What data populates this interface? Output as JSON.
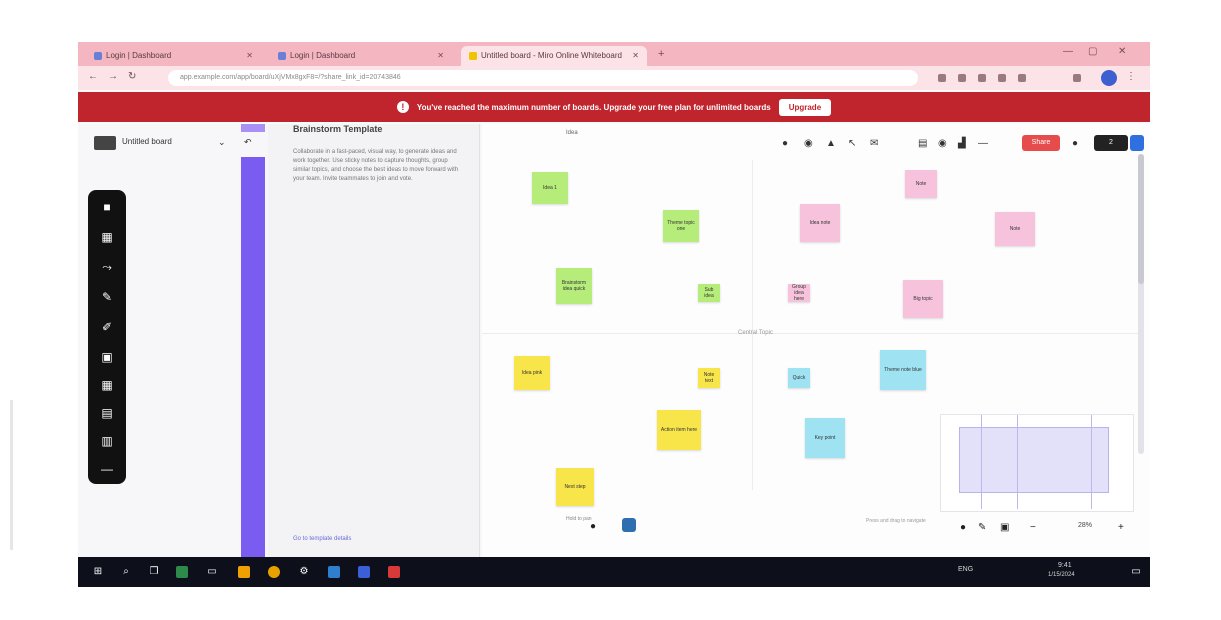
{
  "browser": {
    "tabs": [
      {
        "label": "Login | Dashboard",
        "active": false
      },
      {
        "label": "Login | Dashboard",
        "active": false
      },
      {
        "label": "Untitled board - Miro Online Whiteboard",
        "active": true
      }
    ],
    "url": "app.example.com/app/board/uXjVMx8gxF8=/?share_link_id=20743846"
  },
  "banner": {
    "message": "You've reached the maximum number of boards. Upgrade your free plan for unlimited boards",
    "button": "Upgrade"
  },
  "app": {
    "name": "Untitled board",
    "share_label": "Share",
    "pill_label": "2",
    "zoom_label": "28%"
  },
  "panel": {
    "title": "Brainstorm Template",
    "body": "Collaborate in a fast-paced, visual way, to generate ideas and work together. Use sticky notes to capture thoughts, group similar topics, and choose the best ideas to move forward with your team. Invite teammates to join and vote.",
    "link": "Go to template details"
  },
  "canvas": {
    "top_label": "Idea",
    "center_label": "Central Topic",
    "notes": [
      {
        "text": "Idea 1"
      },
      {
        "text": "Theme topic one"
      },
      {
        "text": "Brainstorm idea quick"
      },
      {
        "text": "Sub idea"
      },
      {
        "text": "Idea note"
      },
      {
        "text": "Note"
      },
      {
        "text": "Note"
      },
      {
        "text": "Group idea here"
      },
      {
        "text": "Big topic"
      },
      {
        "text": "Idea pink"
      },
      {
        "text": "Note text"
      },
      {
        "text": "Action item here"
      },
      {
        "text": "Next step"
      },
      {
        "text": "Quick"
      },
      {
        "text": "Quick"
      },
      {
        "text": "Theme note blue"
      },
      {
        "text": "Key point"
      },
      {
        "text": "Research"
      },
      {
        "text": "Outcome"
      }
    ],
    "bottom_hint": "Hold to pan",
    "bottom_right_hint": "Press and drag to navigate"
  },
  "taskbar": {
    "clock": "9:41",
    "date": "1/15/2024",
    "lang": "ENG"
  }
}
